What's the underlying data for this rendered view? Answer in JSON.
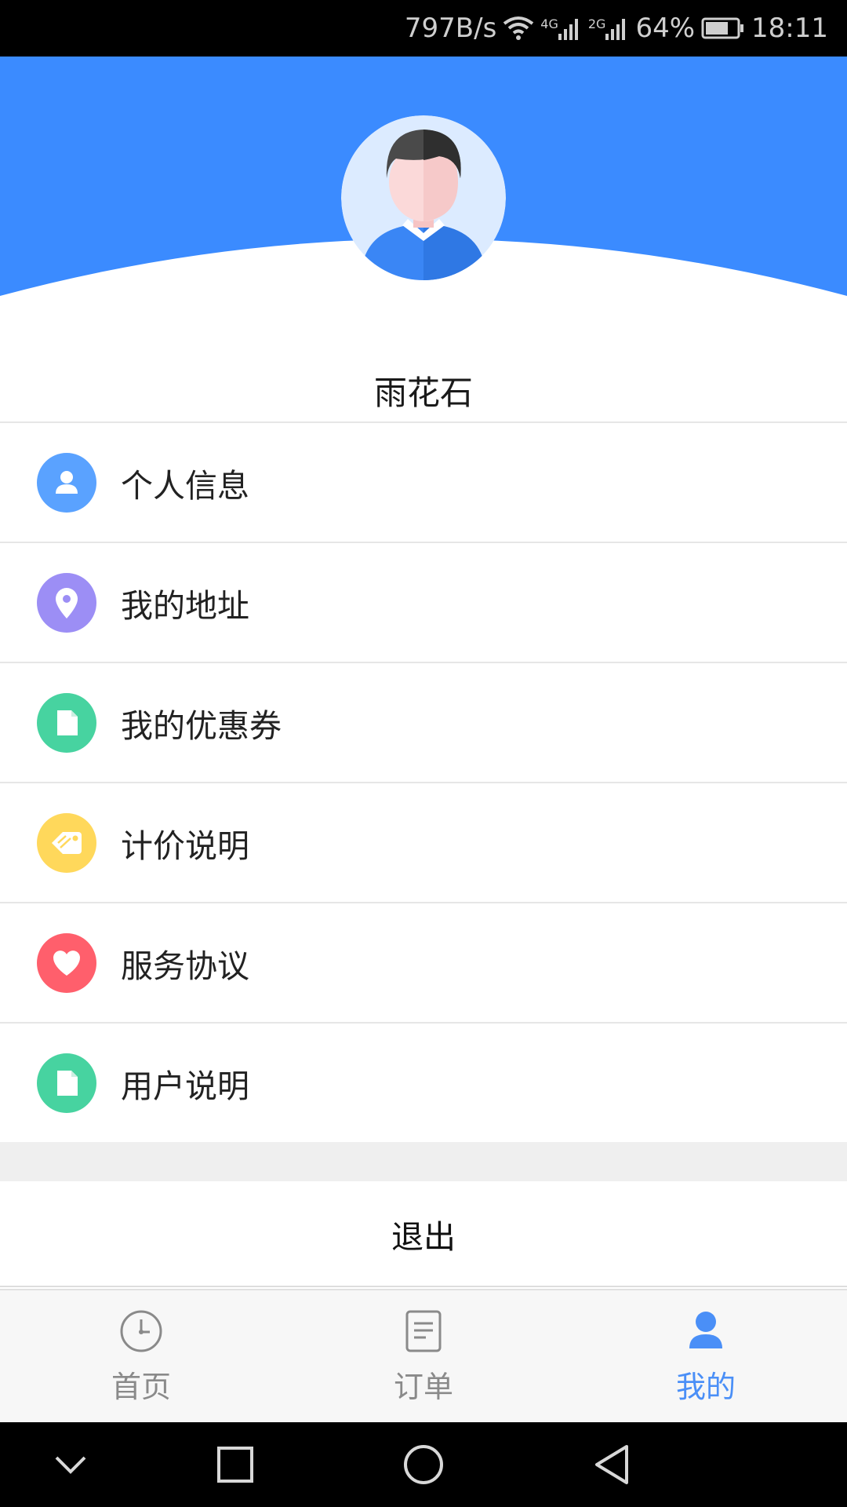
{
  "status_bar": {
    "net_speed": "797B/s",
    "signal_1": "4G",
    "signal_2": "2G",
    "battery": "64%",
    "time": "18:11"
  },
  "profile": {
    "username": "雨花石",
    "header_color": "#3b8bff"
  },
  "menu": [
    {
      "label": "个人信息",
      "icon": "person-icon",
      "color": "#5aa2ff"
    },
    {
      "label": "我的地址",
      "icon": "location-pin-icon",
      "color": "#9c8ef5"
    },
    {
      "label": "我的优惠券",
      "icon": "document-icon",
      "color": "#47d3a0"
    },
    {
      "label": "计价说明",
      "icon": "price-tag-icon",
      "color": "#ffd85b"
    },
    {
      "label": "服务协议",
      "icon": "heart-icon",
      "color": "#ff5f6c"
    },
    {
      "label": "用户说明",
      "icon": "document-icon",
      "color": "#47d3a0"
    }
  ],
  "logout_label": "退出",
  "tabs": [
    {
      "label": "首页",
      "icon": "clock-icon",
      "active": false
    },
    {
      "label": "订单",
      "icon": "order-list-icon",
      "active": false
    },
    {
      "label": "我的",
      "icon": "user-icon",
      "active": true
    }
  ],
  "colors": {
    "accent": "#4a8ff7",
    "inactive": "#8a8a8a"
  }
}
